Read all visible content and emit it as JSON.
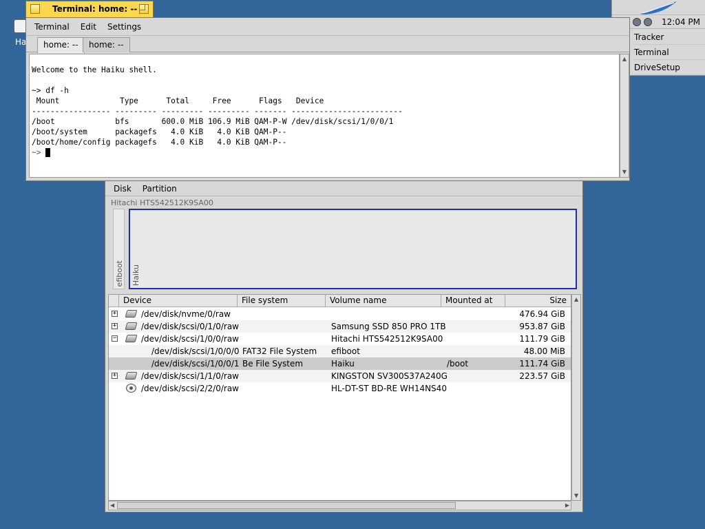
{
  "desktop": {
    "icon_label": "Ha"
  },
  "deskbar": {
    "clock": "12:04 PM",
    "items": [
      "Tracker",
      "Terminal",
      "DriveSetup"
    ]
  },
  "terminal": {
    "title": "Terminal: home: --",
    "menu": [
      "Terminal",
      "Edit",
      "Settings"
    ],
    "tabs": [
      "home: --",
      "home: --"
    ],
    "lines": [
      "Welcome to the Haiku shell.",
      "",
      "~> df -h",
      " Mount             Type      Total     Free      Flags   Device",
      "----------------- --------- --------- --------- ------- ------------------------",
      "/boot             bfs       600.0 MiB 106.9 MiB QAM-P-W /dev/disk/scsi/1/0/0/1",
      "/boot/system      packagefs   4.0 KiB   4.0 KiB QAM-P--",
      "/boot/home/config packagefs   4.0 KiB   4.0 KiB QAM-P--"
    ],
    "prompt": "~> "
  },
  "drivesetup": {
    "menu": [
      "Disk",
      "Partition"
    ],
    "disk_name": "Hitachi HTS542512K9SA00",
    "partitions": [
      "efiboot",
      "Haiku"
    ],
    "columns": [
      "Device",
      "File system",
      "Volume name",
      "Mounted at",
      "Size"
    ],
    "rows": [
      {
        "expander": "+",
        "icon": "hdd-icon",
        "device": "/dev/disk/nvme/0/raw",
        "fs": "",
        "volume": "",
        "mount": "",
        "size": "476.94 GiB",
        "indent": 0
      },
      {
        "expander": "+",
        "icon": "hdd-icon",
        "device": "/dev/disk/scsi/0/1/0/raw",
        "fs": "",
        "volume": "Samsung SSD 850 PRO 1TB",
        "mount": "",
        "size": "953.87 GiB",
        "indent": 0
      },
      {
        "expander": "−",
        "icon": "hdd-icon",
        "device": "/dev/disk/scsi/1/0/0/raw",
        "fs": "",
        "volume": "Hitachi HTS542512K9SA00",
        "mount": "",
        "size": "111.79 GiB",
        "indent": 0
      },
      {
        "expander": "",
        "icon": "",
        "device": "/dev/disk/scsi/1/0/0/0",
        "fs": "FAT32 File System",
        "volume": "efiboot",
        "mount": "",
        "size": "48.00 MiB",
        "indent": 1
      },
      {
        "expander": "",
        "icon": "",
        "device": "/dev/disk/scsi/1/0/0/1",
        "fs": "Be File System",
        "volume": "Haiku",
        "mount": "/boot",
        "size": "111.74 GiB",
        "indent": 1,
        "selected": true
      },
      {
        "expander": "+",
        "icon": "hdd-icon",
        "device": "/dev/disk/scsi/1/1/0/raw",
        "fs": "",
        "volume": "KINGSTON  SV300S37A240G",
        "mount": "",
        "size": "223.57 GiB",
        "indent": 0
      },
      {
        "expander": "",
        "icon": "cd-icon",
        "device": "/dev/disk/scsi/2/2/0/raw",
        "fs": "",
        "volume": "HL-DT-ST BD-RE  WH14NS40",
        "mount": "",
        "size": "",
        "indent": 0
      }
    ]
  }
}
